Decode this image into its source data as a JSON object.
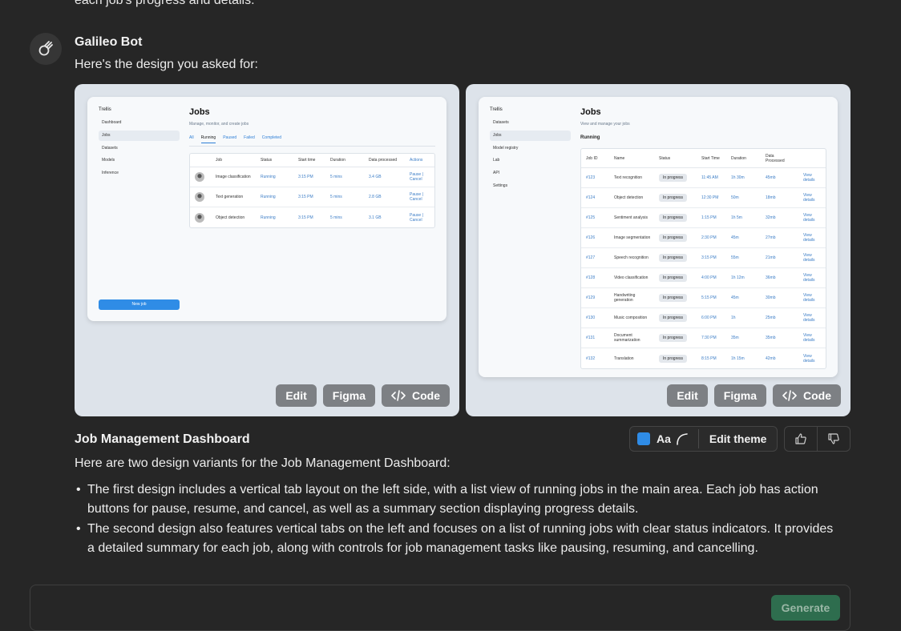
{
  "top_cut_text": "each job's progress and details.",
  "bot": {
    "name": "Galileo Bot",
    "intro": "Here's the design you asked for:"
  },
  "card_actions": {
    "edit": "Edit",
    "figma": "Figma",
    "code": "Code"
  },
  "design1": {
    "app_name": "Trellis",
    "nav": [
      "Dashboard",
      "Jobs",
      "Datasets",
      "Models",
      "Inference"
    ],
    "active_nav": "Jobs",
    "title": "Jobs",
    "subtitle": "Manage, monitor, and create jobs",
    "tabs": [
      "All",
      "Running",
      "Paused",
      "Failed",
      "Completed"
    ],
    "active_tab": "Running",
    "columns": [
      "Job",
      "Status",
      "Start time",
      "Duration",
      "Data processed",
      "Actions"
    ],
    "rows": [
      {
        "job": "Image classification",
        "status": "Running",
        "start": "3:15 PM",
        "duration": "5 mins",
        "data": "3.4 GB",
        "action1": "Pause |",
        "action2": "Cancel"
      },
      {
        "job": "Text generation",
        "status": "Running",
        "start": "3:15 PM",
        "duration": "5 mins",
        "data": "2.8 GB",
        "action1": "Pause |",
        "action2": "Cancel"
      },
      {
        "job": "Object detection",
        "status": "Running",
        "start": "3:15 PM",
        "duration": "5 mins",
        "data": "3.1 GB",
        "action1": "Pause |",
        "action2": "Cancel"
      }
    ],
    "new_job": "New job"
  },
  "design2": {
    "app_name": "Trellis",
    "nav": [
      "Datasets",
      "Jobs",
      "Model registry",
      "Lab",
      "API",
      "Settings"
    ],
    "active_nav": "Jobs",
    "title": "Jobs",
    "subtitle": "View and manage your jobs",
    "section": "Running",
    "columns": [
      "Job ID",
      "Name",
      "Status",
      "Start Time",
      "Duration",
      "Data Processed"
    ],
    "rows": [
      {
        "id": "#123",
        "name": "Text recognition",
        "status": "In progress",
        "start": "11:45 AM",
        "duration": "1h 30m",
        "data": "45mb",
        "action": "View details"
      },
      {
        "id": "#124",
        "name": "Object detection",
        "status": "In progress",
        "start": "12:30 PM",
        "duration": "50m",
        "data": "18mb",
        "action": "View details"
      },
      {
        "id": "#125",
        "name": "Sentiment analysis",
        "status": "In progress",
        "start": "1:15 PM",
        "duration": "1h 5m",
        "data": "32mb",
        "action": "View details"
      },
      {
        "id": "#126",
        "name": "Image segmentation",
        "status": "In progress",
        "start": "2:30 PM",
        "duration": "45m",
        "data": "27mb",
        "action": "View details"
      },
      {
        "id": "#127",
        "name": "Speech recognition",
        "status": "In progress",
        "start": "3:15 PM",
        "duration": "55m",
        "data": "21mb",
        "action": "View details"
      },
      {
        "id": "#128",
        "name": "Video classification",
        "status": "In progress",
        "start": "4:00 PM",
        "duration": "1h 12m",
        "data": "36mb",
        "action": "View details"
      },
      {
        "id": "#129",
        "name": "Handwriting generation",
        "status": "In progress",
        "start": "5:15 PM",
        "duration": "45m",
        "data": "30mb",
        "action": "View details"
      },
      {
        "id": "#130",
        "name": "Music composition",
        "status": "In progress",
        "start": "6:00 PM",
        "duration": "1h",
        "data": "25mb",
        "action": "View details"
      },
      {
        "id": "#131",
        "name": "Document summarization",
        "status": "In progress",
        "start": "7:30 PM",
        "duration": "35m",
        "data": "35mb",
        "action": "View details"
      },
      {
        "id": "#132",
        "name": "Translation",
        "status": "In progress",
        "start": "8:15 PM",
        "duration": "1h 15m",
        "data": "42mb",
        "action": "View details"
      }
    ]
  },
  "result": {
    "title": "Job Management Dashboard",
    "theme_aa": "Aa",
    "edit_theme": "Edit theme",
    "description": "Here are two design variants for the Job Management Dashboard:",
    "bullets": [
      "The first design includes a vertical tab layout on the left side, with a list view of running jobs in the main area. Each job has action buttons for pause, resume, and cancel, as well as a summary section displaying progress details.",
      "The second design also features vertical tabs on the left and focuses on a list of running jobs with clear status indicators. It provides a detailed summary for each job, along with controls for job management tasks like pausing, resuming, and cancelling."
    ]
  },
  "composer": {
    "generate": "Generate"
  },
  "colors": {
    "background": "#262626",
    "accent": "#2f8ce6",
    "generate_bg": "#2e6d4e"
  }
}
